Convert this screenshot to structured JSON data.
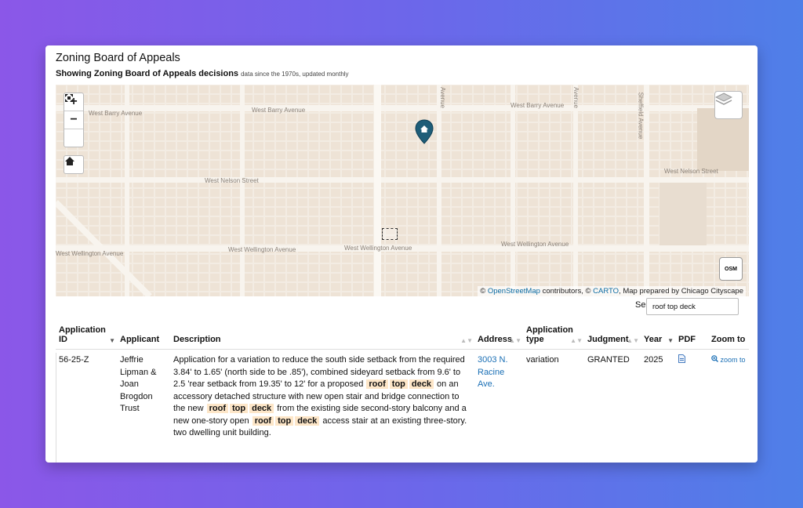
{
  "page": {
    "title": "Zoning Board of Appeals",
    "subtitle": "Showing Zoning Board of Appeals decisions",
    "subtitle_note": "data since the 1970s, updated monthly"
  },
  "map": {
    "streets": {
      "barry_1": "West Barry Avenue",
      "barry_2": "West Barry Avenue",
      "barry_3": "West Barry Avenue",
      "nelson_1": "West Nelson Street",
      "nelson_2": "West Nelson Street",
      "wellington_1": "West Wellington Avenue",
      "wellington_2": "West Wellington Avenue",
      "wellington_3": "West Wellington Avenue",
      "wellington_4": "West Wellington Avenue",
      "sheffield": "Sheffield Avenue",
      "avenue_1": "Avenue",
      "avenue_2": "Avenue"
    },
    "attribution": {
      "prefix": "©",
      "osm_link": "OpenStreetMap",
      "middle": "contributors, ©",
      "carto_link": "CARTO",
      "suffix": ", Map prepared by Chicago Cityscape"
    },
    "controls": {
      "zoom_in": "+",
      "zoom_out": "−",
      "osm_label": "OSM"
    }
  },
  "search": {
    "label": "Search:",
    "value": "roof top deck"
  },
  "table": {
    "headers": {
      "app_id": "Application ID",
      "applicant": "Applicant",
      "description": "Description",
      "address": "Address",
      "app_type": "Application type",
      "judgment": "Judgment",
      "year": "Year",
      "pdf": "PDF",
      "zoom": "Zoom to"
    },
    "rows": [
      {
        "app_id": "56-25-Z",
        "applicant": "Jeffrie Lipman & Joan Brogdon Trust",
        "desc_1": "Application for a variation to reduce the south side setback from the required 3.84' to 1.65' (north side to be .85'), combined sideyard setback from 9.6' to 2.5 'rear setback from 19.35' to 12' for a proposed",
        "desc_2": "on an accessory detached structure with new open stair and bridge connection to the new",
        "desc_3": "from the existing side second-story balcony and a new one-story open",
        "desc_4": "access stair at an existing three-story. two dwelling unit building.",
        "hl_roof": "roof",
        "hl_top": "top",
        "hl_deck": "deck",
        "address": "3003 N. Racine Ave.",
        "app_type": "variation",
        "judgment": "GRANTED",
        "year": "2025",
        "zoom_label": "zoom to"
      }
    ]
  }
}
